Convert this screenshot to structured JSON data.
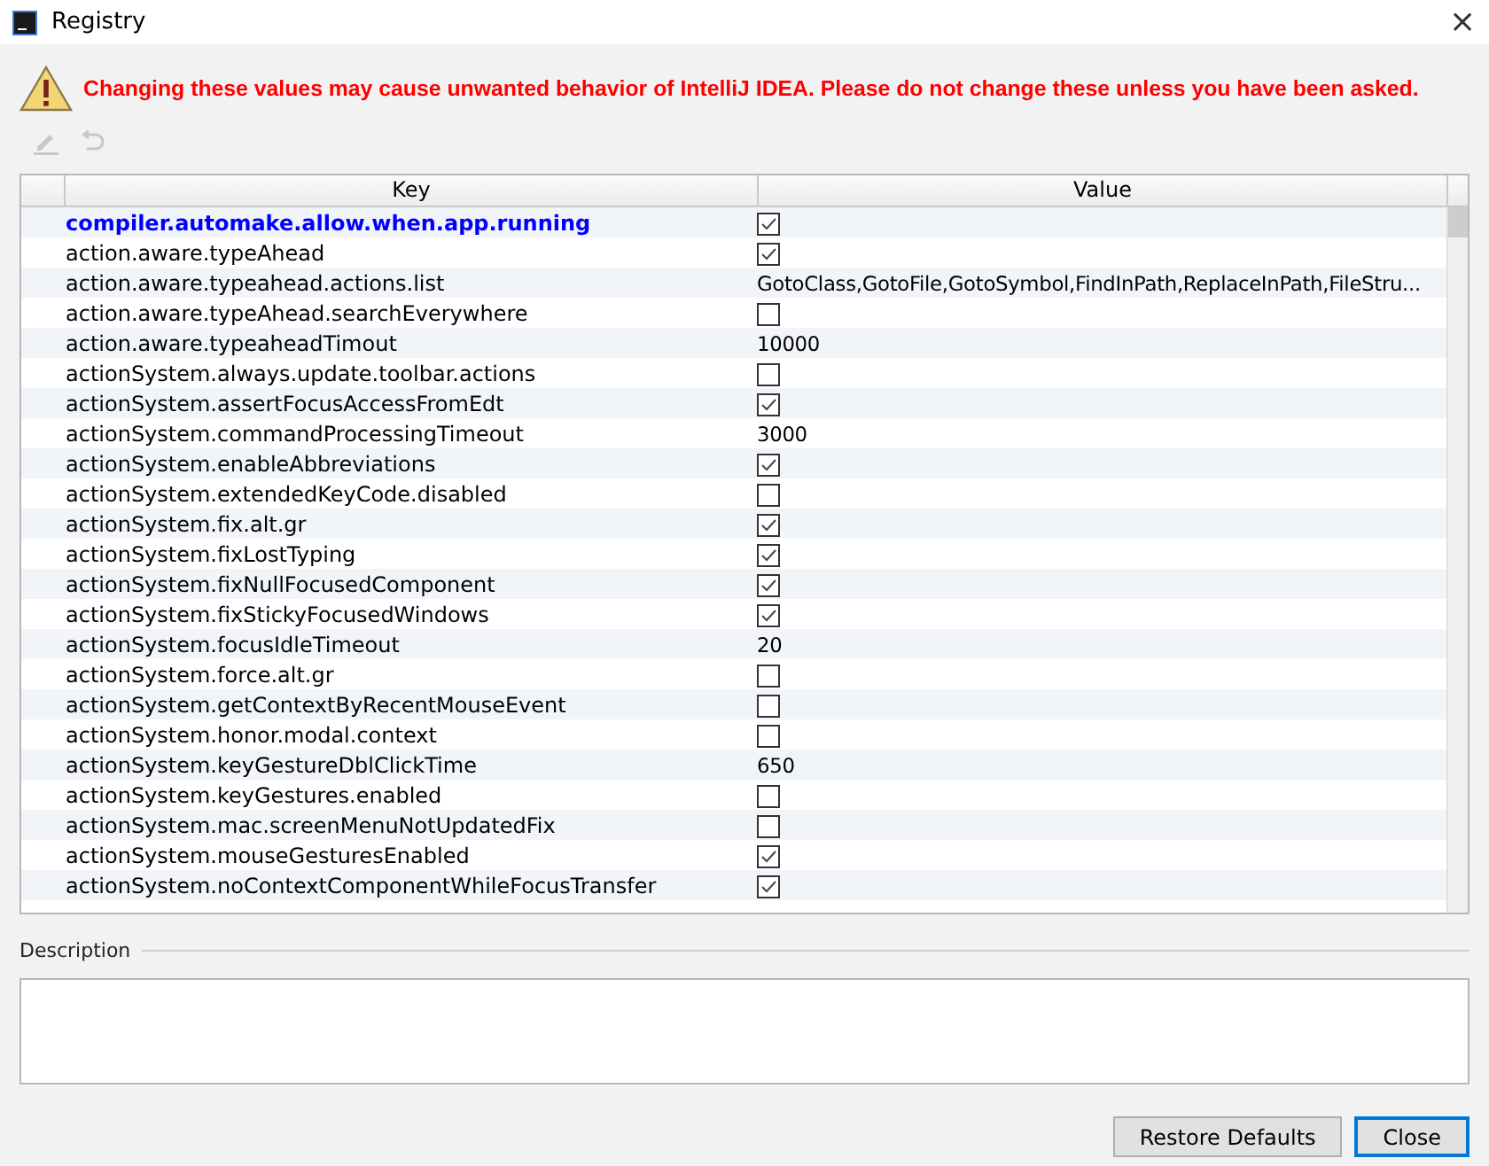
{
  "window": {
    "title": "Registry",
    "close": "×"
  },
  "warning": "Changing these values may cause unwanted behavior of IntelliJ IDEA. Please do not change these unless you have been asked.",
  "table": {
    "columns": [
      "Key",
      "Value"
    ],
    "rows": [
      {
        "key": "compiler.automake.allow.when.app.running",
        "modified": true,
        "kind": "checkbox",
        "checked": true
      },
      {
        "key": "action.aware.typeAhead",
        "modified": false,
        "kind": "checkbox",
        "checked": true
      },
      {
        "key": "action.aware.typeahead.actions.list",
        "modified": false,
        "kind": "text",
        "value": "GotoClass,GotoFile,GotoSymbol,FindInPath,ReplaceInPath,FileStru..."
      },
      {
        "key": "action.aware.typeAhead.searchEverywhere",
        "modified": false,
        "kind": "checkbox",
        "checked": false
      },
      {
        "key": "action.aware.typeaheadTimout",
        "modified": false,
        "kind": "text",
        "value": "10000"
      },
      {
        "key": "actionSystem.always.update.toolbar.actions",
        "modified": false,
        "kind": "checkbox",
        "checked": false
      },
      {
        "key": "actionSystem.assertFocusAccessFromEdt",
        "modified": false,
        "kind": "checkbox",
        "checked": true
      },
      {
        "key": "actionSystem.commandProcessingTimeout",
        "modified": false,
        "kind": "text",
        "value": "3000"
      },
      {
        "key": "actionSystem.enableAbbreviations",
        "modified": false,
        "kind": "checkbox",
        "checked": true
      },
      {
        "key": "actionSystem.extendedKeyCode.disabled",
        "modified": false,
        "kind": "checkbox",
        "checked": false
      },
      {
        "key": "actionSystem.fix.alt.gr",
        "modified": false,
        "kind": "checkbox",
        "checked": true
      },
      {
        "key": "actionSystem.fixLostTyping",
        "modified": false,
        "kind": "checkbox",
        "checked": true
      },
      {
        "key": "actionSystem.fixNullFocusedComponent",
        "modified": false,
        "kind": "checkbox",
        "checked": true
      },
      {
        "key": "actionSystem.fixStickyFocusedWindows",
        "modified": false,
        "kind": "checkbox",
        "checked": true
      },
      {
        "key": "actionSystem.focusIdleTimeout",
        "modified": false,
        "kind": "text",
        "value": "20"
      },
      {
        "key": "actionSystem.force.alt.gr",
        "modified": false,
        "kind": "checkbox",
        "checked": false
      },
      {
        "key": "actionSystem.getContextByRecentMouseEvent",
        "modified": false,
        "kind": "checkbox",
        "checked": false
      },
      {
        "key": "actionSystem.honor.modal.context",
        "modified": false,
        "kind": "checkbox",
        "checked": false
      },
      {
        "key": "actionSystem.keyGestureDblClickTime",
        "modified": false,
        "kind": "text",
        "value": "650"
      },
      {
        "key": "actionSystem.keyGestures.enabled",
        "modified": false,
        "kind": "checkbox",
        "checked": false
      },
      {
        "key": "actionSystem.mac.screenMenuNotUpdatedFix",
        "modified": false,
        "kind": "checkbox",
        "checked": false
      },
      {
        "key": "actionSystem.mouseGesturesEnabled",
        "modified": false,
        "kind": "checkbox",
        "checked": true
      },
      {
        "key": "actionSystem.noContextComponentWhileFocusTransfer",
        "modified": false,
        "kind": "checkbox",
        "checked": true
      }
    ]
  },
  "description": {
    "label": "Description"
  },
  "buttons": [
    {
      "label": "Restore Defaults",
      "focused": false
    },
    {
      "label": "Close",
      "focused": true
    }
  ]
}
